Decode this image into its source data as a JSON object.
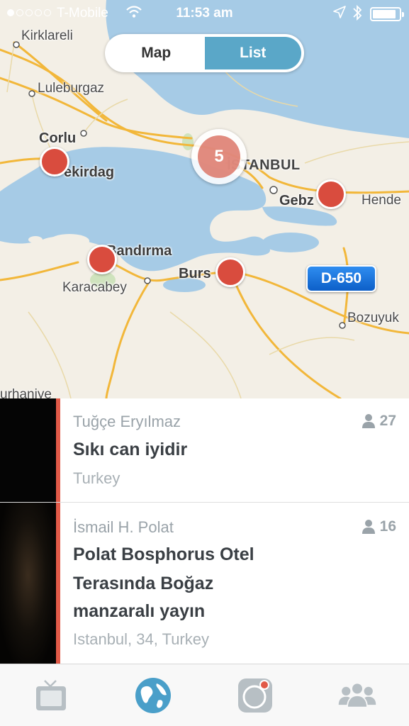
{
  "status_bar": {
    "carrier": "T-Mobile",
    "time": "11:53 am",
    "signal_bars_filled": 1,
    "signal_bars_total": 5,
    "battery_level": 0.9,
    "icons": [
      "signal-dots-icon",
      "wifi-icon",
      "location-arrow-icon",
      "bluetooth-icon",
      "battery-icon"
    ]
  },
  "view_toggle": {
    "map_label": "Map",
    "list_label": "List",
    "selected": "List"
  },
  "map": {
    "labels": {
      "kirklareli": "Kirklareli",
      "luleburgaz": "Luleburgaz",
      "corlu": "Corlu",
      "tekirdag": "ekirdag",
      "istanbul": "İSTANBUL",
      "gebze": "Gebz",
      "hendek": "Hende",
      "bandirma": "Bandırma",
      "karacabey": "Karacabey",
      "bursa": "Burs",
      "bozuyuk": "Bozuyuk",
      "karacabey_south": "urhaniye"
    },
    "cluster_count": "5",
    "road_sign": "D-650",
    "colors": {
      "water": "#a6cbe6",
      "land": "#f3efe6",
      "road": "#f2b73a",
      "pin": "#d94c3e"
    }
  },
  "broadcasts": [
    {
      "user": "Tuğçe Eryılmaz",
      "title": "Sıkı can iyidir",
      "location": "Turkey",
      "viewers": "27"
    },
    {
      "user": "İsmail H. Polat",
      "title_lines": [
        "Polat Bosphorus Otel",
        "Terasında Boğaz",
        "manzaralı yayın"
      ],
      "location": "Istanbul, 34, Turkey",
      "viewers": "16"
    }
  ],
  "tab_bar": {
    "tabs": [
      "tv-icon",
      "globe-icon",
      "camera-record-icon",
      "people-icon"
    ],
    "active": "globe-icon",
    "accent_color": "#4a9fc9"
  }
}
